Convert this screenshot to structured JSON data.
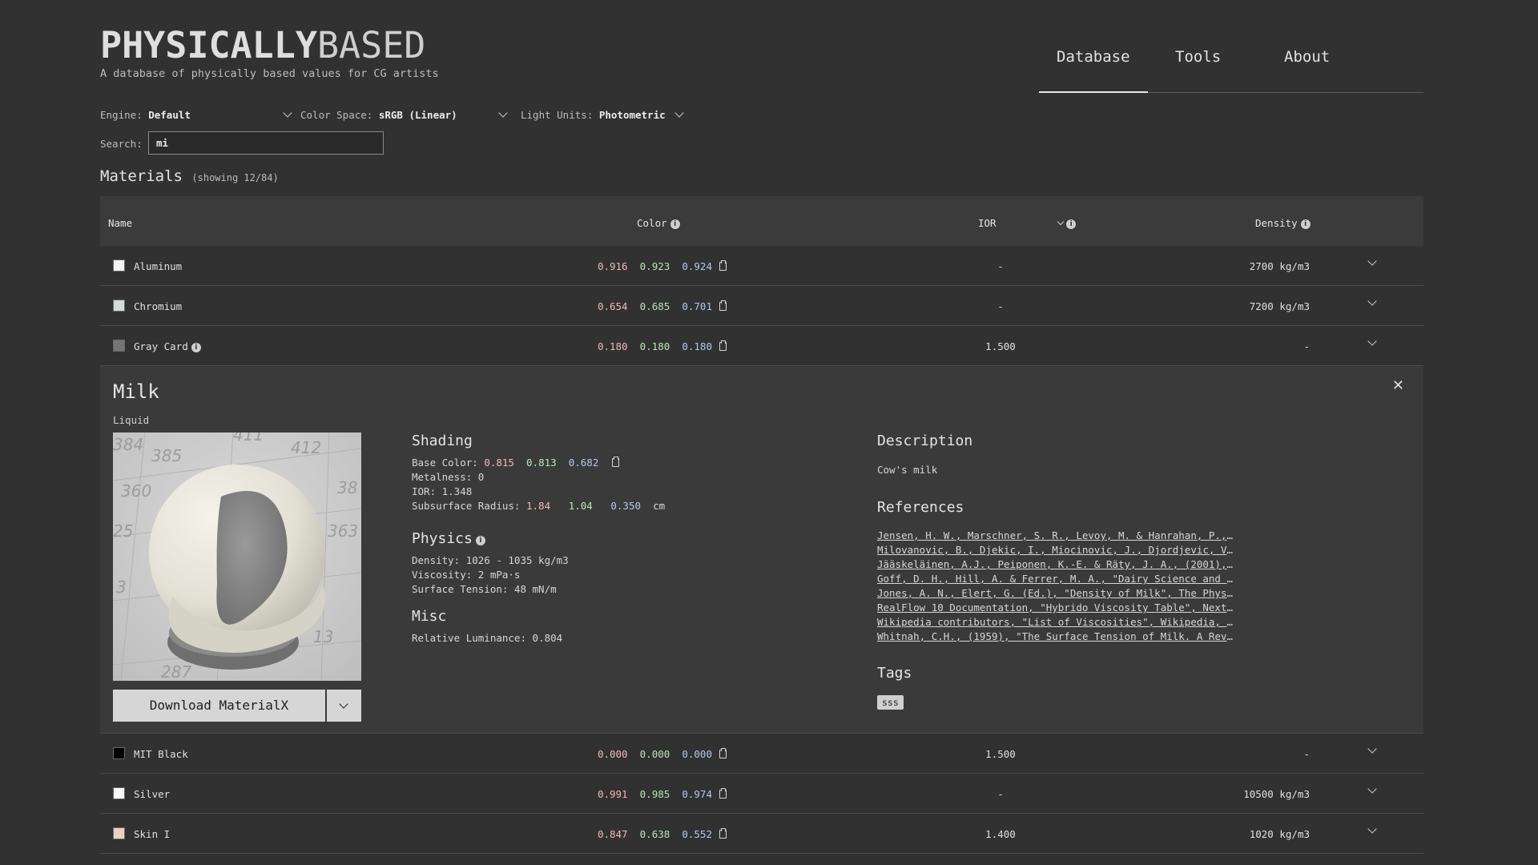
{
  "brand": {
    "bold": "PHYSICALLY",
    "light": "BASED",
    "tagline": "A database of physically based values for CG artists"
  },
  "nav": [
    {
      "label": "Database",
      "active": true
    },
    {
      "label": "Tools",
      "active": false
    },
    {
      "label": "About",
      "active": false
    }
  ],
  "filters": {
    "engine_label": "Engine:",
    "engine_value": "Default",
    "colorspace_label": "Color Space:",
    "colorspace_value": "sRGB (Linear)",
    "lightunits_label": "Light Units:",
    "lightunits_value": "Photometric",
    "search_label": "Search:",
    "search_value": "mi"
  },
  "section": {
    "title": "Materials",
    "count": "(showing 12/84)"
  },
  "table": {
    "headers": {
      "name": "Name",
      "color": "Color",
      "ior": "IOR",
      "density": "Density"
    },
    "rows_top": [
      {
        "name": "Aluminum",
        "swatch": "#f4f5f5",
        "r": "0.916",
        "g": "0.923",
        "b": "0.924",
        "ior": "-",
        "density": "2700  kg/m3"
      },
      {
        "name": "Chromium",
        "swatch": "#d5dadb",
        "r": "0.654",
        "g": "0.685",
        "b": "0.701",
        "ior": "-",
        "density": "7200  kg/m3"
      },
      {
        "name": "Gray Card",
        "swatch": "#757575",
        "r": "0.180",
        "g": "0.180",
        "b": "0.180",
        "ior": "1.500",
        "density": "-"
      }
    ],
    "rows_bottom": [
      {
        "name": "MIT Black",
        "swatch": "#000000",
        "r": "0.000",
        "g": "0.000",
        "b": "0.000",
        "ior": "1.500",
        "density": "-"
      },
      {
        "name": "Silver",
        "swatch": "#fcfbfa",
        "r": "0.991",
        "g": "0.985",
        "b": "0.974",
        "ior": "-",
        "density": "10500  kg/m3"
      },
      {
        "name": "Skin I",
        "swatch": "#eed0c3",
        "r": "0.847",
        "g": "0.638",
        "b": "0.552",
        "ior": "1.400",
        "density": "1020  kg/m3"
      }
    ]
  },
  "detail": {
    "title": "Milk",
    "category": "Liquid",
    "download_label": "Download MaterialX",
    "shading": {
      "heading": "Shading",
      "base_color_label": "Base Color:",
      "r": "0.815",
      "g": "0.813",
      "b": "0.682",
      "metalness": "Metalness:  0",
      "ior": "IOR: 1.348",
      "sss_label": "Subsurface Radius:",
      "sss_r": "1.84",
      "sss_g": "1.04",
      "sss_b": "0.350",
      "sss_unit": "cm"
    },
    "physics": {
      "heading": "Physics",
      "density": "Density: 1026 - 1035  kg/m3",
      "viscosity": "Viscosity:  2  mPa·s",
      "surface_tension": "Surface Tension:  48  mN/m"
    },
    "misc": {
      "heading": "Misc",
      "luminance": "Relative Luminance: 0.804"
    },
    "description": {
      "heading": "Description",
      "text": "Cow's milk"
    },
    "references": {
      "heading": "References",
      "items": [
        "Jensen, H. W., Marschner, S. R., Levoy, M. & Hanrahan, P., ...",
        "Milovanovic, B., Djekic, I., Miocinovic, J., Djordjevic, V....",
        "Jääskeläinen, A.J., Peiponen, K.-E. & Räty, J. A., (2001), ...",
        "Goff, D. H., Hill, A. & Ferrer, M. A., \"Dairy Science and T...",
        "Jones, A. N., Elert, G. (Ed.), \"Density of Milk\", The Physi...",
        "RealFlow 10 Documentation, \"Hybrido Viscosity Table\", Next ...",
        "Wikipedia contributors, \"List of Viscosities\", Wikipedia, T...",
        "Whitnah, C.H., (1959), \"The Surface Tension of Milk. A Revi..."
      ]
    },
    "tags": {
      "heading": "Tags",
      "items": [
        "sss"
      ]
    },
    "preview_numbers": [
      "384",
      "385",
      "411",
      "412",
      "360",
      "38",
      "25",
      "363",
      "3",
      "13",
      "287"
    ]
  }
}
